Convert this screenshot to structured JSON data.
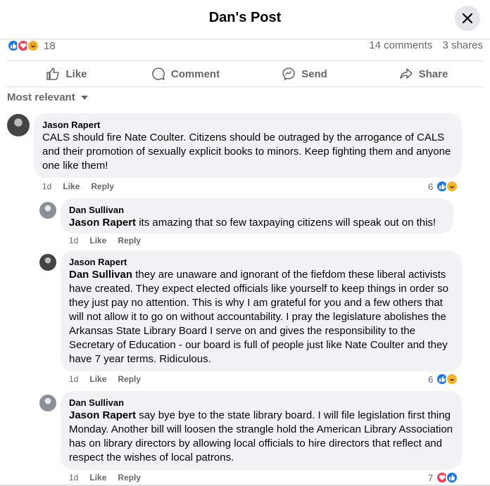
{
  "header": {
    "title": "Dan's Post"
  },
  "stats": {
    "reaction_count": "18",
    "comments": "14 comments",
    "shares": "3 shares"
  },
  "actions": {
    "like": "Like",
    "comment": "Comment",
    "send": "Send",
    "share": "Share"
  },
  "sort": {
    "label": "Most relevant"
  },
  "colors": {
    "like_blue": "#1877f2",
    "love_red": "#f33e58",
    "haha_yellow": "#f7b125",
    "bubble_bg": "#f0f2f5"
  },
  "comments": [
    {
      "author": "Jason Rapert",
      "mention": "",
      "text": "CALS should fire Nate Coulter. Citizens should be outraged by the arrogance of CALS and their promotion of sexually explicit books to minors. Keep fighting them and anyone one like them!",
      "time": "1d",
      "like": "Like",
      "reply": "Reply",
      "reactions": "6"
    },
    {
      "author": "Dan Sullivan",
      "mention": "Jason Rapert",
      "text": "its amazing that so few taxpaying citizens will speak out on this!",
      "time": "1d",
      "like": "Like",
      "reply": "Reply",
      "reactions": ""
    },
    {
      "author": "Jason Rapert",
      "mention": "Dan Sullivan",
      "text": "they are unaware and ignorant of the fiefdom these liberal activists have created. They expect elected officials like yourself to keep things in order so they just pay no attention. This is why I am grateful for you and a few others that will not allow it to go on without accountability. I pray the legislature abolishes the Arkansas State Library Board I serve on and gives the responsibility to the Secretary of Education - our board is full of people just like Nate Coulter and they have 7 year terms. Ridiculous.",
      "time": "1d",
      "like": "Like",
      "reply": "Reply",
      "reactions": "6"
    },
    {
      "author": "Dan Sullivan",
      "mention": "Jason Rapert",
      "text": "say bye bye to the state library board. I will file legislation first thing Monday. Another bill will loosen the strangle hold the American Library Association has on library directors by allowing local officials to hire directors that reflect and respect the wishes of local patrons.",
      "time": "1d",
      "like": "Like",
      "reply": "Reply",
      "reactions": "7"
    }
  ]
}
